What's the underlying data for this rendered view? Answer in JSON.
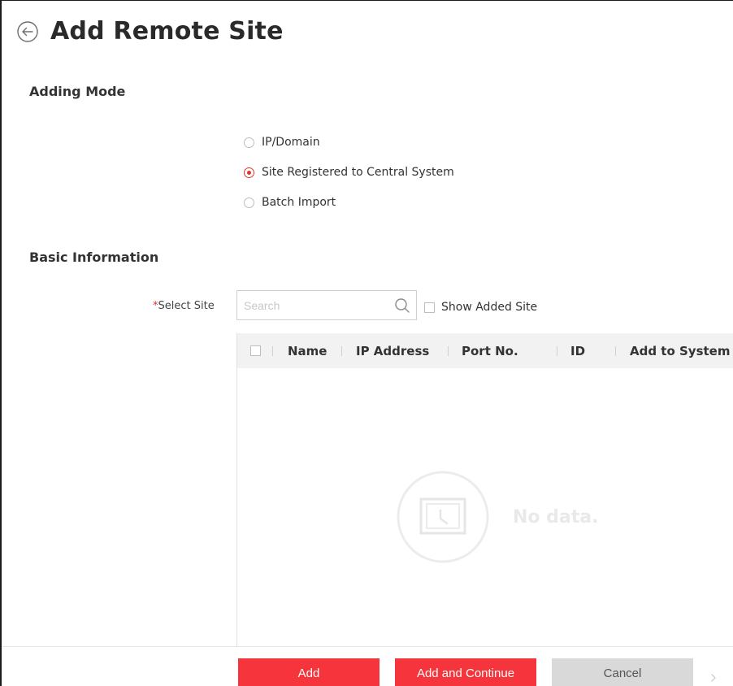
{
  "header": {
    "title": "Add Remote Site",
    "back_icon": "arrow-left-circle-icon"
  },
  "adding_mode": {
    "title": "Adding Mode",
    "options": [
      {
        "label": "IP/Domain",
        "selected": false
      },
      {
        "label": "Site Registered to Central System",
        "selected": true
      },
      {
        "label": "Batch Import",
        "selected": false
      }
    ]
  },
  "basic_info": {
    "title": "Basic Information",
    "select_site": {
      "required_mark": "*",
      "label": "Select Site",
      "placeholder": "Search",
      "value": ""
    },
    "show_added_site": {
      "label": "Show Added Site",
      "checked": false
    }
  },
  "table": {
    "columns": [
      "Name",
      "IP Address",
      "Port No.",
      "ID",
      "Add to System"
    ],
    "rows": [],
    "empty_text": "No data."
  },
  "footer": {
    "add_label": "Add",
    "add_continue_label": "Add and Continue",
    "cancel_label": "Cancel"
  },
  "colors": {
    "accent": "#f5343c",
    "radio_selected": "#e5322d",
    "header_bg": "#f2f2f2",
    "disabled_bg": "#d9d9d9"
  }
}
